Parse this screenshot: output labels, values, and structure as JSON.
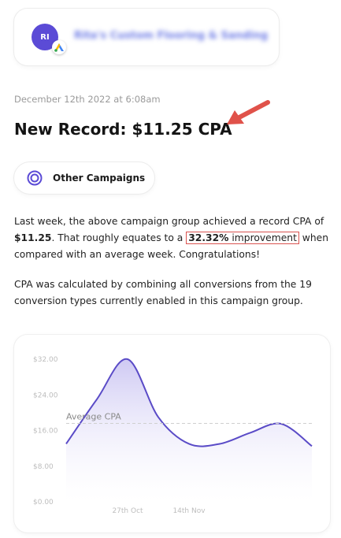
{
  "account": {
    "initials": "RI",
    "name": "Rita's Custom Flooring & Sanding"
  },
  "record": {
    "timestamp": "December 12th 2022 at 6:08am",
    "headline": "New Record: $11.25 CPA"
  },
  "filter_pill": {
    "label": "Other Campaigns",
    "icon": "target-circle-icon"
  },
  "body": {
    "p1_part1": "Last week, the above campaign group achieved a record CPA of ",
    "p1_value": "$11.25",
    "p1_part2": ". That roughly equates to a ",
    "p1_improvement_pct": "32.32%",
    "p1_improvement_word": " improvement",
    "p1_part3": " when compared with an average week. Congratulations!",
    "p2": "CPA was calculated by combining all conversions from the 19 conversion types currently enabled in this campaign group."
  },
  "colors": {
    "accent": "#5b4bd6",
    "line": "#5a4bc7",
    "highlight_border": "#d9534f",
    "arrow": "#e0524a"
  },
  "chart_data": {
    "type": "area",
    "y_ticks": [
      "$32.00",
      "$24.00",
      "$16.00",
      "$8.00",
      "$0.00"
    ],
    "ylim": [
      0,
      32
    ],
    "x_tick_labels": [
      "27th Oct",
      "14th Nov"
    ],
    "x": [
      0,
      1,
      2,
      3,
      4,
      5,
      6,
      7,
      8
    ],
    "values": [
      13,
      23,
      32,
      19,
      13,
      13,
      15.5,
      17.5,
      12.5
    ],
    "x_tick_positions": [
      2,
      4
    ],
    "average": {
      "label": "Average CPA",
      "value": 17.6
    },
    "grid": false
  }
}
